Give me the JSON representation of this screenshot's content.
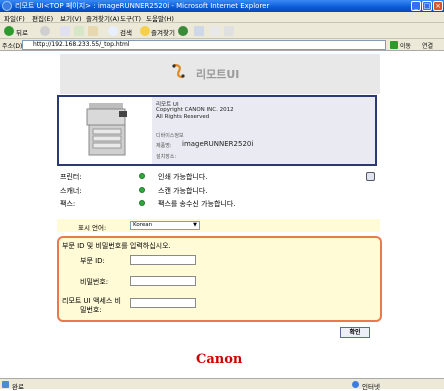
{
  "window": {
    "title": "리모트 UI<TOP 페이지> : imageRUNNER2520i - Microsoft Internet Explorer",
    "min_symbol": "_",
    "max_symbol": "□",
    "close_symbol": "×"
  },
  "menu": [
    "파일(F)",
    "편집(E)",
    "보기(V)",
    "즐겨찾기(A)",
    "도구(T)",
    "도움말(H)"
  ],
  "toolbar": {
    "back_label": "뒤로",
    "search_label": "검색",
    "favorites_label": "즐겨찾기"
  },
  "address": {
    "label": "주소(D)",
    "url": "http://192.168.233.55/_top.html",
    "go_label": "이동",
    "links_label": "연결"
  },
  "brand": {
    "title": "리모트UI",
    "canon": "Canon"
  },
  "device": {
    "app_name": "리모트 UI",
    "copyright": "Copyright CANON INC. 2012",
    "rights": "All Rights Reserved",
    "device_info_label": "디바이스정보",
    "product_label": "제품명:",
    "product_name": "imageRUNNER2520i",
    "location_label": "설치장소:"
  },
  "status": [
    {
      "label": "프린터:",
      "text": "인쇄 가능합니다."
    },
    {
      "label": "스캐너:",
      "text": "스캔 가능합니다."
    },
    {
      "label": "팩스:",
      "text": "팩스를 송수신 가능합니다."
    }
  ],
  "language": {
    "label": "표시 언어:",
    "selected": "Korean"
  },
  "login": {
    "prompt": "부문 ID 및 비밀번호를 입력하십시오.",
    "dept_id_label": "부문 ID:",
    "password_label": "비밀번호:",
    "remote_pw_label_line1": "리모트 UI 액세스 비",
    "remote_pw_label_line2": "밀번호:",
    "confirm_label": "확인"
  },
  "statusbar": {
    "left": "완료",
    "right": "인터넷"
  },
  "colors": {
    "login_border": "#e87a4e",
    "panel_border": "#2b3a74",
    "ok_green": "#2eaa3a",
    "canon_red": "#cc0000"
  }
}
